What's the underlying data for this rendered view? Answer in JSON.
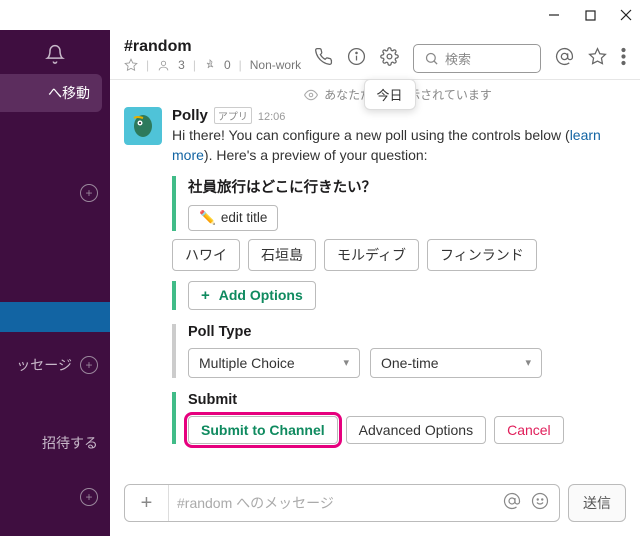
{
  "sidebar": {
    "jump_label": "へ移動",
    "messages_label": "ッセージ",
    "invite_label": "招待する"
  },
  "header": {
    "channel_name": "#random",
    "member_count": "3",
    "pin_count": "0",
    "topic": "Non-work",
    "search_placeholder": "検索",
    "tooltip": "今日"
  },
  "canvas": {
    "only_you": "あなただけに表示されています",
    "bot_name": "Polly",
    "app_badge": "アプリ",
    "time": "12:06",
    "text_pre": "Hi there! You can configure a new poll using the controls below (",
    "text_link": "learn more",
    "text_post": "). Here's a preview of your question:",
    "poll": {
      "question": "社員旅行はどこに行きたい？",
      "edit_icon": "✏️",
      "edit_label": "edit title",
      "options": [
        "ハワイ",
        "石垣島",
        "モルディブ",
        "フィンランド"
      ],
      "add_label": "Add Options"
    },
    "type_section": {
      "title": "Poll Type",
      "select1": "Multiple Choice",
      "select2": "One-time"
    },
    "submit_section": {
      "title": "Submit",
      "submit": "Submit to Channel",
      "advanced": "Advanced Options",
      "cancel": "Cancel"
    }
  },
  "composer": {
    "placeholder": "#random へのメッセージ",
    "send": "送信"
  }
}
